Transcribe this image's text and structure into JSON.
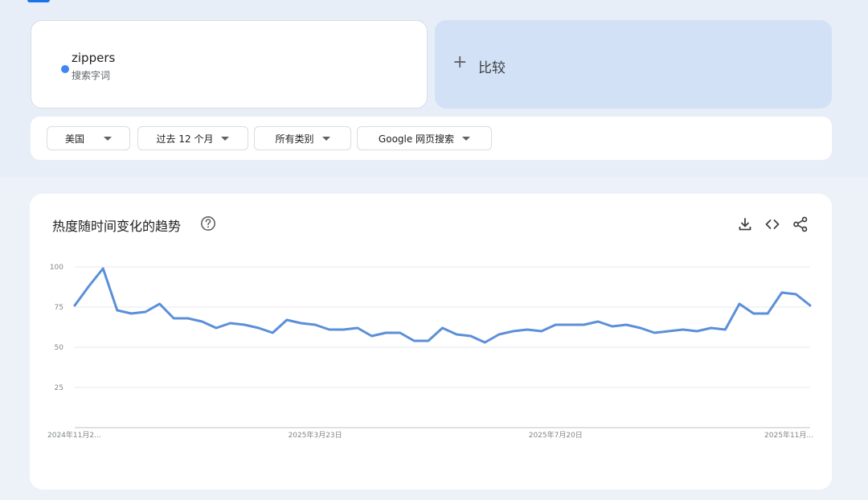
{
  "search_term": {
    "name": "zippers",
    "subtitle": "搜索字词",
    "color": "#4285f4"
  },
  "compare": {
    "label": "比较"
  },
  "filters": {
    "region": "美国",
    "time_range": "过去 12 个月",
    "category": "所有类别",
    "search_type": "Google 网页搜索"
  },
  "chart_section": {
    "title": "热度随时间变化的趋势",
    "icons": [
      "help-icon",
      "download-icon",
      "embed-icon",
      "share-icon"
    ]
  },
  "chart_data": {
    "type": "line",
    "title": "热度随时间变化的趋势",
    "xlabel": "",
    "ylabel": "",
    "ylim": [
      0,
      100
    ],
    "yticks": [
      25,
      50,
      75,
      100
    ],
    "grid": true,
    "x_tick_labels": [
      "2024年11月2...",
      "2025年3月23日",
      "2025年7月20日",
      "2025年11月..."
    ],
    "x_tick_indices": [
      0,
      17,
      34,
      52
    ],
    "series": [
      {
        "color": "#5b8fd9",
        "values": [
          76,
          88,
          99,
          73,
          71,
          72,
          77,
          68,
          68,
          66,
          62,
          65,
          64,
          62,
          59,
          67,
          65,
          64,
          61,
          61,
          62,
          57,
          59,
          59,
          54,
          54,
          62,
          58,
          57,
          53,
          58,
          60,
          61,
          60,
          64,
          64,
          64,
          66,
          63,
          64,
          62,
          59,
          60,
          61,
          60,
          62,
          61,
          77,
          71,
          71,
          84,
          83,
          76
        ]
      }
    ]
  }
}
